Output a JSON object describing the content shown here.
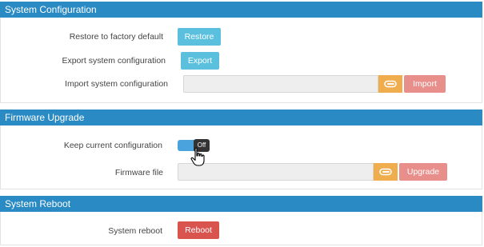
{
  "system_configuration": {
    "title": "System Configuration",
    "restore_label": "Restore to factory default",
    "restore_button": "Restore",
    "export_label": "Export system configuration",
    "export_button": "Export",
    "import_label": "Import system configuration",
    "import_button": "Import"
  },
  "firmware_upgrade": {
    "title": "Firmware Upgrade",
    "keep_label": "Keep current configuration",
    "keep_toggle_state": "Off",
    "firmware_label": "Firmware file",
    "upgrade_button": "Upgrade"
  },
  "system_reboot": {
    "title": "System Reboot",
    "reboot_label": "System reboot",
    "reboot_button": "Reboot"
  },
  "colors": {
    "header": "#2a8ac4",
    "info_button": "#5bc0de",
    "danger_button": "#d9534f",
    "attach_button": "#f0ad4e",
    "toggle_on": "#4aa3dd"
  },
  "icons": {
    "attach": "paperclip-icon",
    "cursor": "hand-pointer-icon"
  }
}
